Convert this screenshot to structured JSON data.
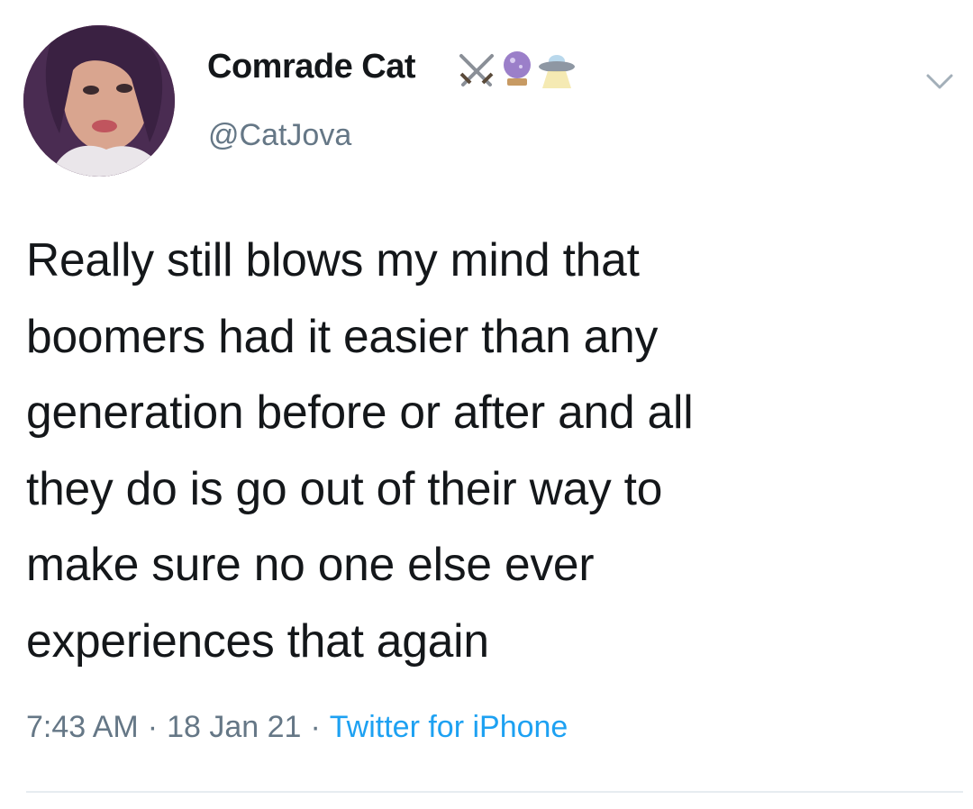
{
  "tweet": {
    "author": {
      "display_name": "Comrade Cat",
      "name_emojis": [
        "crossed-swords-icon",
        "crystal-ball-icon",
        "ufo-icon"
      ],
      "handle": "@CatJova"
    },
    "text_lines": [
      "Really still blows my mind that",
      "boomers had it easier than any",
      "generation before or after and all",
      "they do is go out of their way to",
      "make sure no one else ever",
      "experiences that again"
    ],
    "meta": {
      "time": "7:43 AM",
      "date": "18 Jan 21",
      "separator": "·",
      "source": "Twitter for iPhone"
    },
    "menu_icon": "chevron-down-icon"
  },
  "colors": {
    "text": "#14171a",
    "secondary": "#657786",
    "link": "#1da1f2",
    "divider": "#e6ecf0"
  }
}
